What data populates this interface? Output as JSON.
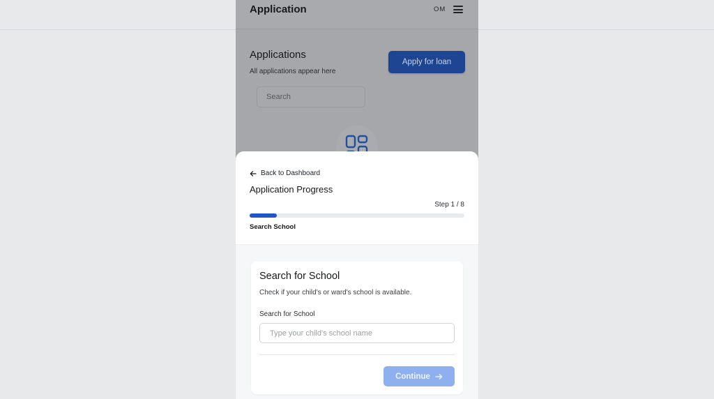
{
  "header": {
    "title": "Application",
    "initials": "OM"
  },
  "applications": {
    "heading": "Applications",
    "subtitle": "All applications appear here",
    "apply_button": "Apply for loan",
    "search_placeholder": "Search"
  },
  "sheet": {
    "back_label": "Back to Dashboard",
    "progress_title": "Application Progress",
    "step_label": "Step 1 / 8",
    "progress_fraction": 0.125,
    "step_name": "Search School"
  },
  "card": {
    "title": "Search for School",
    "subtitle": "Check if your child's or ward's school is available.",
    "field_label": "Search for School",
    "input_value": "",
    "input_placeholder": "Type your child's school name",
    "continue_label": "Continue"
  },
  "colors": {
    "accent": "#1f57c8",
    "apply_button_bg": "#1d4592",
    "continue_disabled_bg": "#8fb0ee"
  },
  "icons": {
    "menu": "hamburger-menu-icon",
    "applications": "grid-apps-icon",
    "back": "arrow-left-icon",
    "continue": "arrow-right-icon"
  }
}
